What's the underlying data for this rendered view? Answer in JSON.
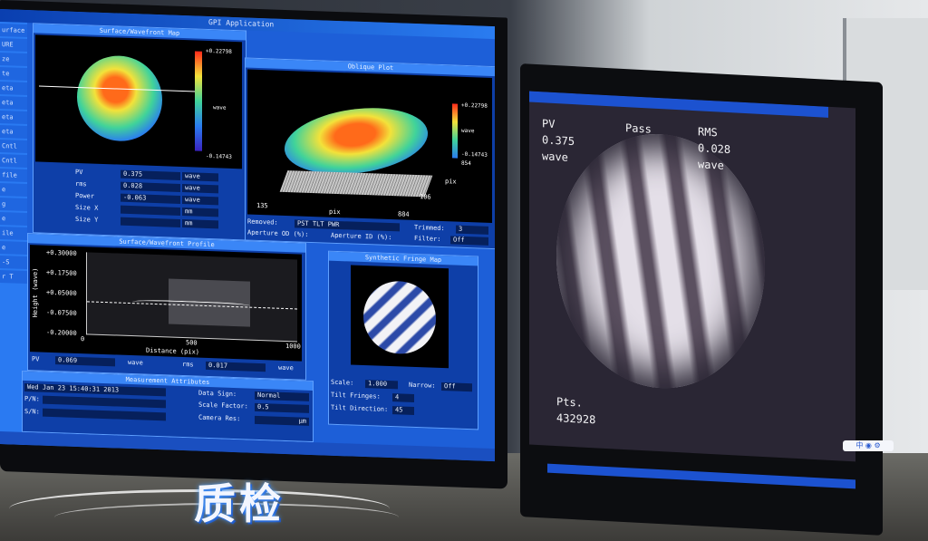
{
  "left_app": {
    "window_title": "GPI Application",
    "sidebar_items": [
      "urface",
      "URE",
      "ze",
      "te",
      "eta",
      "eta",
      "eta",
      "eta",
      "Cntl",
      "Cntl",
      "file",
      "e",
      "g",
      "e",
      "ile",
      "e",
      "-S",
      "r T"
    ],
    "surface_map": {
      "title": "Surface/Wavefront Map",
      "scale_top": "+0.22798",
      "scale_bottom": "-0.14743",
      "scale_unit": "wave",
      "rows": [
        {
          "label": "PV",
          "value": "0.375",
          "unit": "wave"
        },
        {
          "label": "rms",
          "value": "0.028",
          "unit": "wave"
        },
        {
          "label": "Power",
          "value": "-0.063",
          "unit": "wave"
        },
        {
          "label": "Size X",
          "value": "",
          "unit": "mm"
        },
        {
          "label": "Size Y",
          "value": "",
          "unit": "mm"
        }
      ]
    },
    "oblique_plot": {
      "title": "Oblique Plot",
      "scale_top": "+0.22798",
      "scale_bottom": "-0.14743",
      "scale_unit": "wave",
      "axis_x_a": "135",
      "axis_x_b": "pix",
      "axis_x_c": "884",
      "axis_y_a": "106",
      "axis_y_b": "pix",
      "axis_z_tick": "854",
      "removed_label": "Removed:",
      "removed_value": "PST TLT PWR",
      "trimmed_label": "Trimmed:",
      "trimmed_value": "3"
    },
    "aperture": {
      "od_label": "Aperture OD (%):",
      "id_label": "Aperture ID (%):",
      "filter_label": "Filter:",
      "filter_value": "Off"
    },
    "profile": {
      "title": "Surface/Wavefront Profile",
      "ylabel": "Height (wave)",
      "yticks": [
        "+0.30000",
        "+0.17500",
        "+0.05000",
        "-0.07500",
        "-0.20000"
      ],
      "xticks": [
        "0",
        "500",
        "1000"
      ],
      "xlabel": "Distance (pix)",
      "pv_label": "PV",
      "pv_value": "0.069",
      "pv_unit": "wave",
      "rms_label": "rms",
      "rms_value": "0.017",
      "rms_unit": "wave"
    },
    "fringe_map": {
      "title": "Synthetic Fringe Map",
      "scale_label": "Scale:",
      "scale_value": "1.000",
      "narrow_label": "Narrow:",
      "narrow_value": "Off",
      "tilt_fringes_label": "Tilt Fringes:",
      "tilt_fringes_value": "4",
      "tilt_direction_label": "Tilt Direction:",
      "tilt_direction_value": "45"
    },
    "measurement": {
      "title": "Measurement Attributes",
      "date": "Wed Jan 23 15:40:31 2013",
      "sn_label": "P/N:",
      "sn2_label": "S/N:",
      "data_sign_label": "Data Sign:",
      "data_sign_value": "Normal",
      "scale_factor_label": "Scale Factor:",
      "scale_factor_value": "0.5",
      "camera_res_label": "Camera Res:",
      "camera_res_value": "μm"
    }
  },
  "right_app": {
    "pv_label": "PV",
    "pv_value": "0.375",
    "pv_unit": "wave",
    "pass_label": "Pass",
    "rms_label": "RMS",
    "rms_value": "0.028",
    "rms_unit": "wave",
    "pts_label": "Pts.",
    "pts_value": "432928"
  },
  "overlay": {
    "logo_text": "质检",
    "controls": "中 ◉ ⚙"
  },
  "colors": {
    "screen_blue": "#1d5fd8",
    "accent": "#3a86f7"
  }
}
